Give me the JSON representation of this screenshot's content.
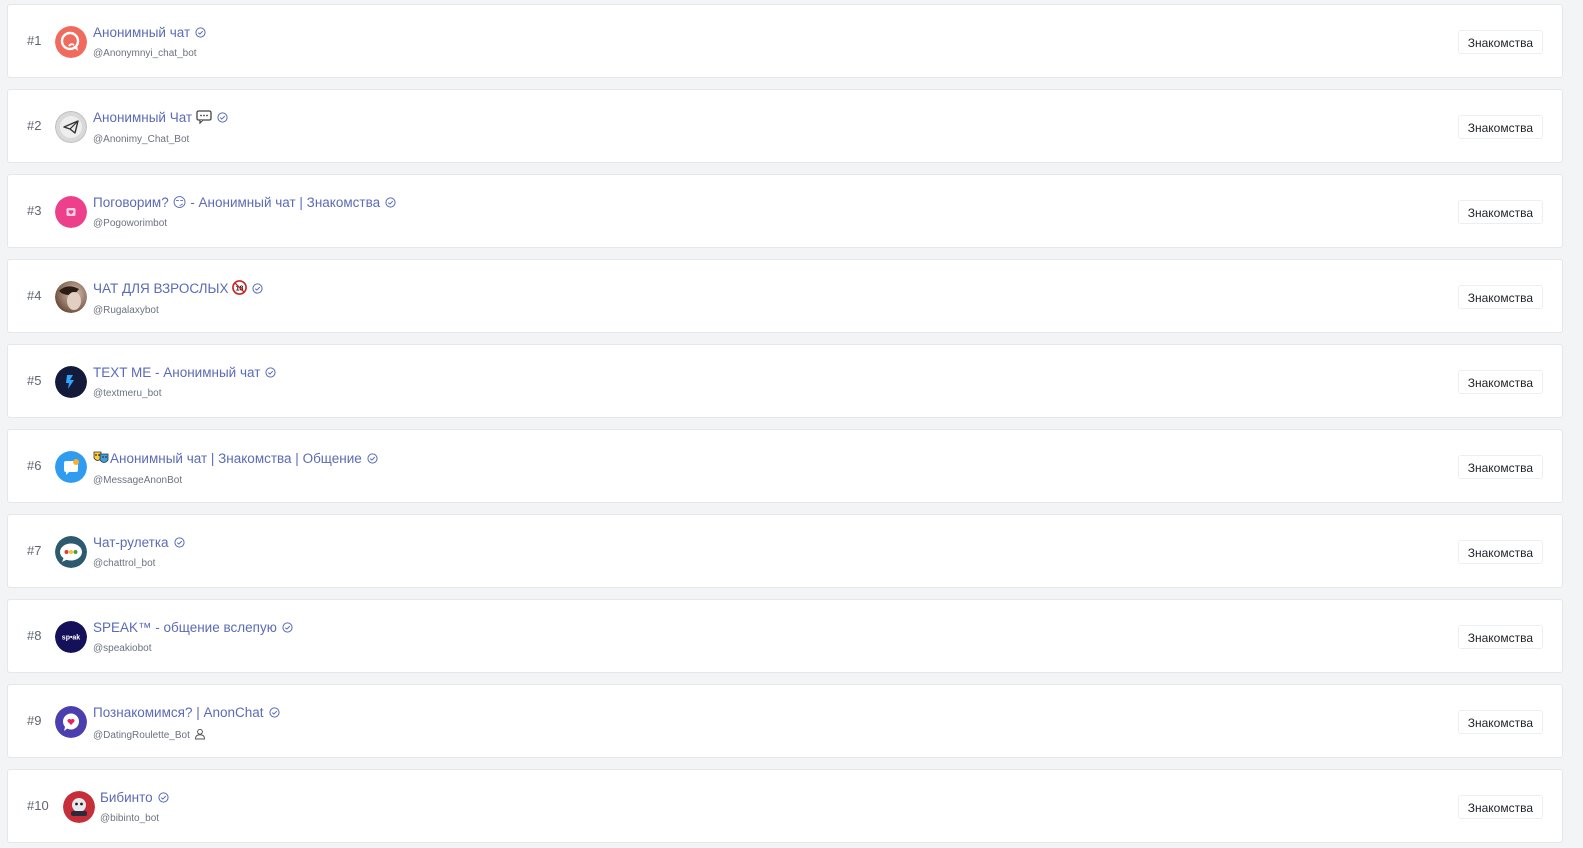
{
  "bots": [
    {
      "rank": "#1",
      "title": "Анонимный чат",
      "handle": "@Anonymnyi_chat_bot",
      "category": "Знакомства",
      "avatar_icon": "red-chat-bubble-avatar"
    },
    {
      "rank": "#2",
      "title": "Анонимный Чат",
      "handle": "@Anonimy_Chat_Bot",
      "category": "Знакомства",
      "avatar_icon": "paper-plane-avatar",
      "title_emoji": "speech-balloon-emoji"
    },
    {
      "rank": "#3",
      "title": "Поговорим? 😏 - Анонимный чат | Знакомства",
      "handle": "@Pogoworimbot",
      "category": "Знакомства",
      "avatar_icon": "pink-heart-avatar"
    },
    {
      "rank": "#4",
      "title": "ЧАТ ДЛЯ ВЗРОСЛЫХ",
      "handle": "@Rugalaxybot",
      "category": "Знакомства",
      "avatar_icon": "photo-avatar",
      "title_emoji": "18-plus-emoji"
    },
    {
      "rank": "#5",
      "title": "TEXT ME - Анонимный чат",
      "handle": "@textmeru_bot",
      "category": "Знакомства",
      "avatar_icon": "text-me-avatar"
    },
    {
      "rank": "#6",
      "title": "Анонимный чат | Знакомства | Общение",
      "handle": "@MessageAnonBot",
      "category": "Знакомства",
      "avatar_icon": "blue-message-avatar",
      "title_emoji_prefix": "masks-emoji"
    },
    {
      "rank": "#7",
      "title": "Чат-рулетка",
      "handle": "@chattrol_bot",
      "category": "Знакомства",
      "avatar_icon": "dots-bubble-avatar"
    },
    {
      "rank": "#8",
      "title": "SPEAK™ - общение вслепую",
      "handle": "@speakiobot",
      "category": "Знакомства",
      "avatar_icon": "speak-logo-avatar",
      "avatar_text": "sp•ak"
    },
    {
      "rank": "#9",
      "title": "Познакомимся? | AnonChat",
      "handle": "@DatingRoulette_Bot",
      "category": "Знакомства",
      "avatar_icon": "purple-heart-avatar",
      "handle_icon": "user-icon"
    },
    {
      "rank": "#10",
      "title": "Бибинто",
      "handle": "@bibinto_bot",
      "category": "Знакомства",
      "avatar_icon": "bibinto-avatar"
    }
  ],
  "colors": {
    "title": "#5b6bb5",
    "background": "#f3f4f6",
    "card": "#ffffff"
  }
}
